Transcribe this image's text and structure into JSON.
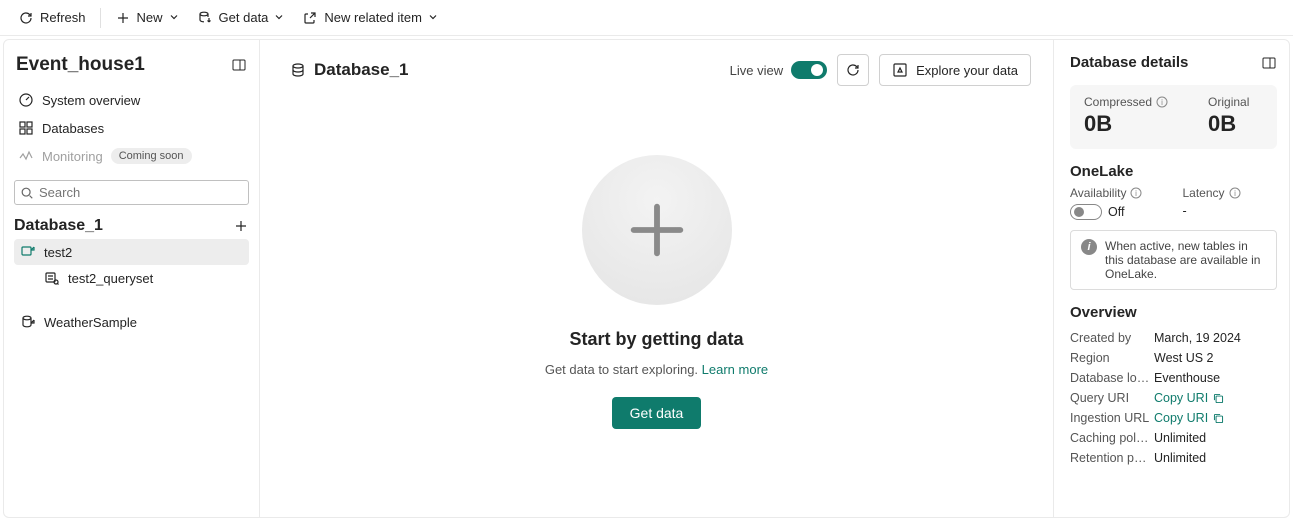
{
  "cmd": {
    "refresh": "Refresh",
    "new": "New",
    "get_data": "Get data",
    "new_related": "New related item"
  },
  "sidebar": {
    "title": "Event_house1",
    "nav": {
      "overview": "System overview",
      "databases": "Databases",
      "monitoring": "Monitoring",
      "monitoring_badge": "Coming soon"
    },
    "search_placeholder": "Search",
    "db_title": "Database_1",
    "tree": {
      "test2": "test2",
      "test2_queryset": "test2_queryset",
      "weather": "WeatherSample"
    }
  },
  "main": {
    "db_name": "Database_1",
    "live_view": "Live view",
    "explore": "Explore your data",
    "start_title": "Start by getting data",
    "start_sub": "Get data to start exploring. ",
    "learn_more": "Learn more",
    "get_data_btn": "Get data"
  },
  "details": {
    "title": "Database details",
    "compressed_label": "Compressed",
    "compressed_value": "0B",
    "original_label": "Original",
    "original_value": "0B",
    "onelake_title": "OneLake",
    "availability_label": "Availability",
    "availability_value": "Off",
    "latency_label": "Latency",
    "latency_value": "-",
    "info_text": "When active, new tables in this database are available in OneLake.",
    "overview_title": "Overview",
    "kv": {
      "created_by_k": "Created by",
      "created_by_v": "March, 19 2024",
      "region_k": "Region",
      "region_v": "West US 2",
      "location_k": "Database locati...",
      "location_v": "Eventhouse",
      "query_uri_k": "Query URI",
      "query_uri_v": "Copy URI",
      "ingestion_url_k": "Ingestion URL",
      "ingestion_url_v": "Copy URI",
      "caching_k": "Caching policy",
      "caching_v": "Unlimited",
      "retention_k": "Retention policy",
      "retention_v": "Unlimited"
    }
  }
}
